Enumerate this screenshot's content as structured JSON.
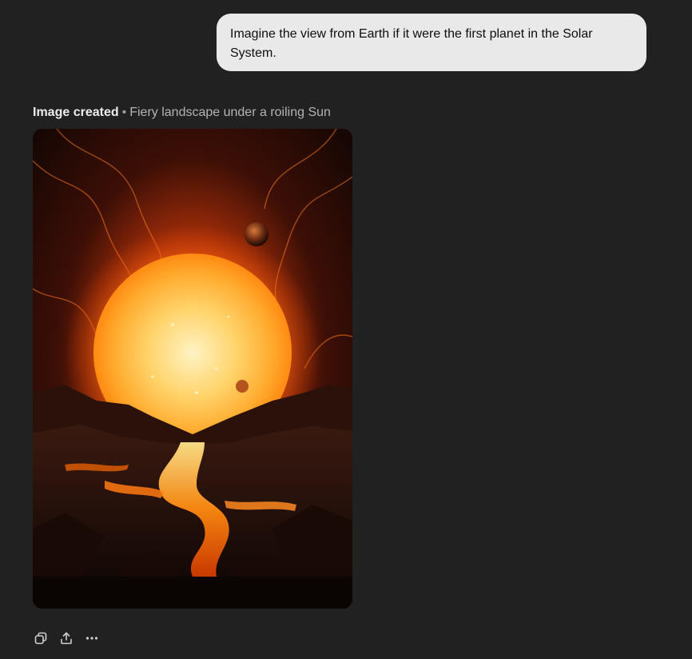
{
  "conversation": {
    "user_message": "Imagine the view from Earth if it were the first planet in the Solar System.",
    "image_result": {
      "status": "Image created",
      "separator": "•",
      "title": "Fiery landscape under a roiling Sun"
    },
    "actions": [
      {
        "icon": "copy-icon"
      },
      {
        "icon": "share-icon"
      },
      {
        "icon": "more-options-icon"
      }
    ]
  },
  "colors": {
    "background": "#212121",
    "user_bubble": "#e9e9e9",
    "sun_core": "#ffe9a8",
    "sun_edge": "#ff9a1f",
    "lava": "#ff6a00"
  }
}
